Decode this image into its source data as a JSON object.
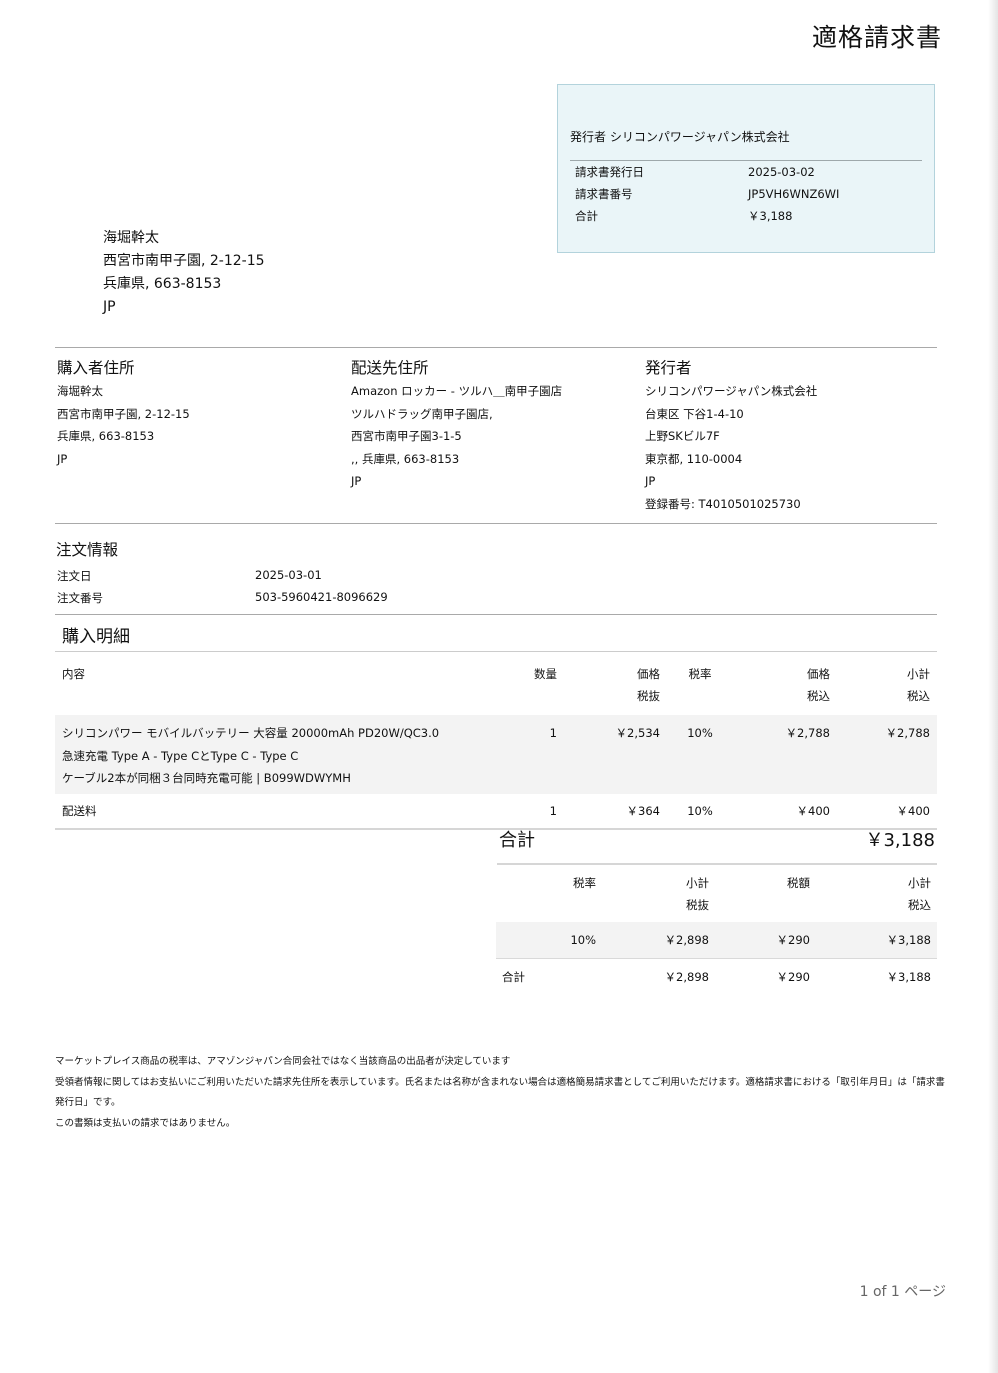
{
  "document": {
    "title": "適格請求書"
  },
  "summary": {
    "issuer_line": "発行者 シリコンパワージャパン株式会社",
    "rows": [
      {
        "label": "請求書発行日",
        "value": "2025-03-02"
      },
      {
        "label": "請求書番号",
        "value": "JP5VH6WNZ6WI"
      },
      {
        "label": "合計",
        "value": "￥3,188"
      }
    ]
  },
  "mailing_address": [
    "海堀幹太",
    "西宮市南甲子園, 2-12-15",
    "兵庫県, 663-8153",
    "JP"
  ],
  "buyer": {
    "heading": "購入者住所",
    "lines": [
      "海堀幹太",
      "西宮市南甲子園, 2-12-15",
      "兵庫県, 663-8153",
      "JP"
    ]
  },
  "shipping": {
    "heading": "配送先住所",
    "lines": [
      "Amazon ロッカー - ツルハ＿南甲子園店",
      "ツルハドラッグ南甲子園店,",
      "西宮市南甲子園3-1-5",
      ",, 兵庫県, 663-8153",
      "JP"
    ]
  },
  "seller": {
    "heading": "発行者",
    "lines": [
      "シリコンパワージャパン株式会社",
      "台東区 下谷1-4-10",
      "上野SKビル7F",
      "東京都, 110-0004",
      "JP",
      "登録番号: T4010501025730"
    ]
  },
  "order": {
    "heading": "注文情報",
    "date_label": "注文日",
    "date_value": "2025-03-01",
    "number_label": "注文番号",
    "number_value": "503-5960421-8096629"
  },
  "items": {
    "heading": "購入明細",
    "headers": {
      "content": "内容",
      "qty": "数量",
      "price": "価格",
      "price_sub": "税抜",
      "rate": "税率",
      "price_incl": "価格",
      "price_incl_sub": "税込",
      "subtotal": "小計",
      "subtotal_sub": "税込"
    },
    "rows": [
      {
        "desc_lines": [
          "シリコンパワー モバイルバッテリー 大容量 20000mAh PD20W/QC3.0",
          "急速充電 Type A - Type CとType C - Type C",
          "ケーブル2本が同梱３台同時充電可能 | B099WDWYMH"
        ],
        "qty": "1",
        "price": "￥2,534",
        "rate": "10%",
        "price_incl": "￥2,788",
        "subtotal": "￥2,788"
      },
      {
        "desc_lines": [
          "配送料"
        ],
        "qty": "1",
        "price": "￥364",
        "rate": "10%",
        "price_incl": "￥400",
        "subtotal": "￥400"
      }
    ]
  },
  "total": {
    "label": "合計",
    "value": "￥3,188"
  },
  "tax_summary": {
    "headers": {
      "rate": "税率",
      "subtotal": "小計",
      "subtotal_sub": "税抜",
      "tax": "税額",
      "total": "小計",
      "total_sub": "税込"
    },
    "rows": [
      {
        "label": "",
        "rate": "10%",
        "subtotal": "￥2,898",
        "tax": "￥290",
        "total": "￥3,188"
      },
      {
        "label": "合計",
        "rate": "",
        "subtotal": "￥2,898",
        "tax": "￥290",
        "total": "￥3,188"
      }
    ]
  },
  "notes": [
    "マーケットプレイス商品の税率は、アマゾンジャパン合同会社ではなく当該商品の出品者が決定しています",
    "受領者情報に関してはお支払いにご利用いただいた請求先住所を表示しています。氏名または名称が含まれない場合は適格簡易請求書としてご利用いただけます。適格請求書における「取引年月日」は「請求書発行日」です。",
    "この書類は支払いの請求ではありません。"
  ],
  "pager": {
    "current": "1",
    "of": "of",
    "total": "1",
    "suffix": "ページ"
  }
}
